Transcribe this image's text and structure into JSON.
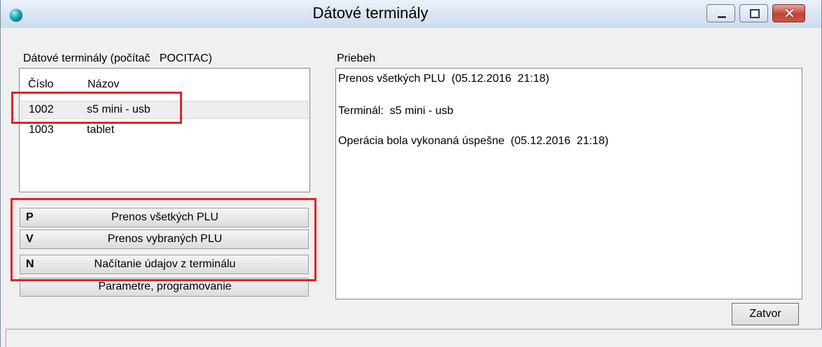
{
  "window": {
    "title": "Dátové terminály",
    "icon": "teal-orb-icon",
    "controls": [
      "minimize-icon",
      "maximize-icon",
      "close-icon"
    ],
    "close_glyph": "✕"
  },
  "terminals": {
    "label": "Dátové terminály (počítač   POCITAC)",
    "columns": [
      "Číslo",
      "Názov"
    ],
    "rows": [
      {
        "number": "1002",
        "name": "s5 mini - usb",
        "selected": true
      },
      {
        "number": "1003",
        "name": "tablet",
        "selected": false
      }
    ]
  },
  "actions": [
    {
      "key": "P",
      "label": "Prenos všetkých PLU"
    },
    {
      "key": "V",
      "label": "Prenos vybraných PLU"
    },
    {
      "key": "N",
      "label": "Načítanie údajov z terminálu"
    },
    {
      "key": "",
      "label": "Parametre, programovanie"
    }
  ],
  "progress": {
    "label": "Priebeh",
    "lines": [
      "Prenos všetkých PLU  (05.12.2016  21:18)",
      "Terminál:  s5 mini - usb",
      "Operácia bola vykonaná úspešne  (05.12.2016  21:18)"
    ]
  },
  "close_button": "Zatvor",
  "colors": {
    "highlight": "#e2232a",
    "titlebar": "#dbe7f4",
    "window_bg": "#f0f0f0"
  }
}
